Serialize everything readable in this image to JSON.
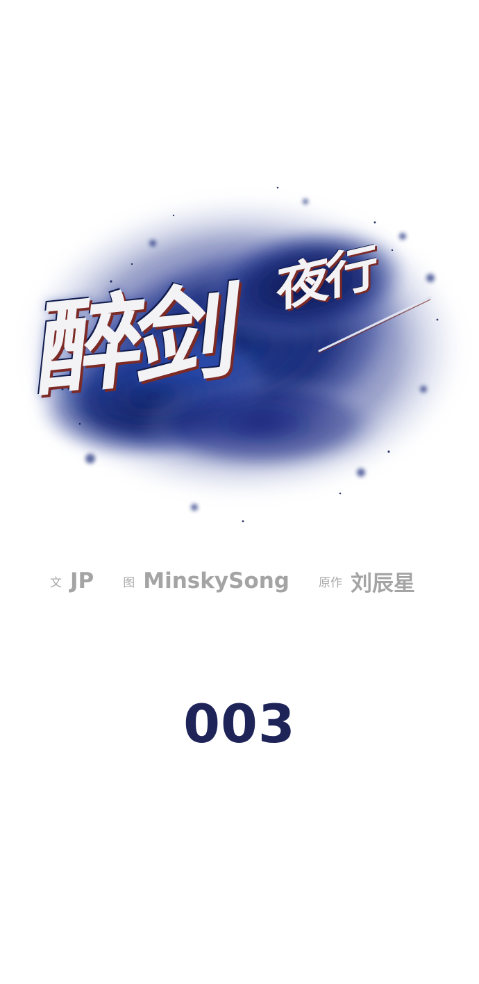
{
  "title": {
    "main": "醉剑",
    "sub": "夜行"
  },
  "credits": [
    {
      "role": "文",
      "name": "JP"
    },
    {
      "role": "图",
      "name": "MinskySong"
    },
    {
      "role": "原作",
      "name": "刘辰星"
    }
  ],
  "episode": "003",
  "colors": {
    "background": "#ffffff",
    "ink_splash": "#1c2d7a",
    "ink_deep": "#0c1650",
    "title_fill": "#f3f3f6",
    "title_shadow": "#7c2a26",
    "credits_text": "#a4a4a4",
    "episode_text": "#1e2457"
  }
}
